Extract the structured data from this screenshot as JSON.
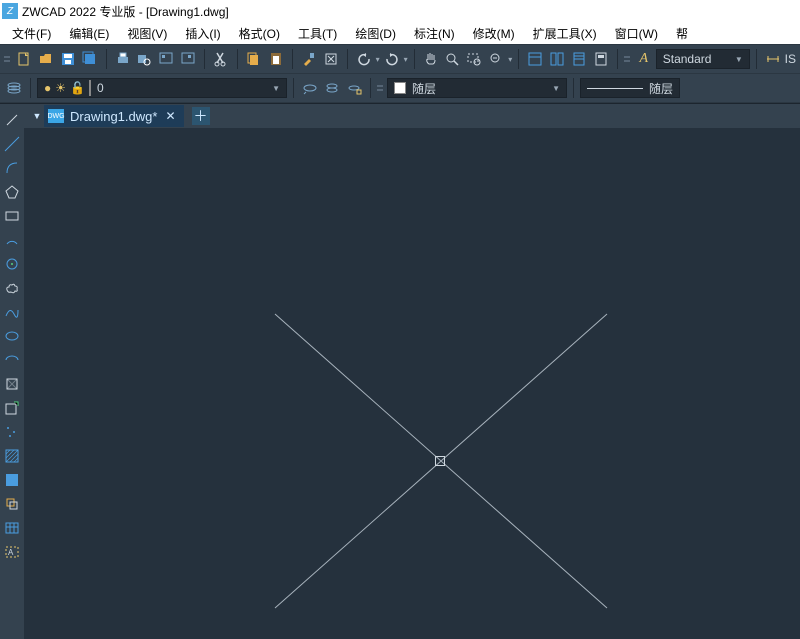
{
  "title": "ZWCAD 2022 专业版 - [Drawing1.dwg]",
  "menu": {
    "file": "文件(F)",
    "edit": "编辑(E)",
    "view": "视图(V)",
    "insert": "插入(I)",
    "format": "格式(O)",
    "tools": "工具(T)",
    "draw": "绘图(D)",
    "annotate": "标注(N)",
    "modify": "修改(M)",
    "exttools": "扩展工具(X)",
    "window": "窗口(W)",
    "help": "帮"
  },
  "toolbar": {
    "textstyle": "Standard",
    "iso": "IS"
  },
  "layer": {
    "name": "0",
    "bylayer": "随层",
    "linetype": "随层"
  },
  "tabs": {
    "active": "Drawing1.dwg*"
  }
}
